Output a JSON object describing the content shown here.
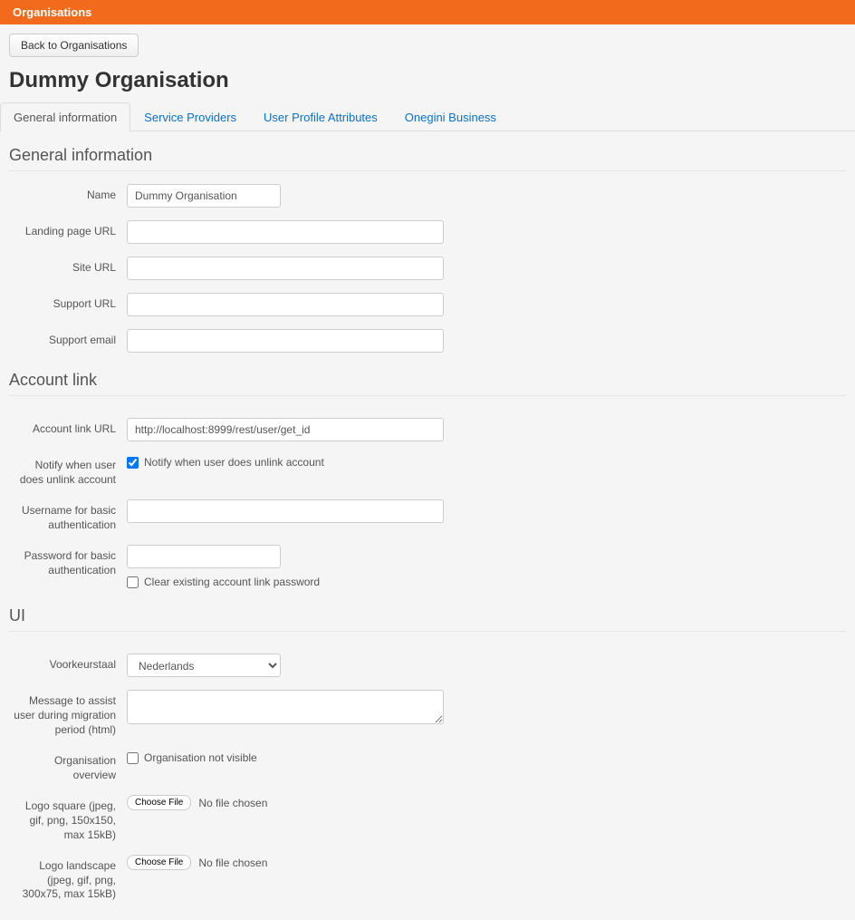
{
  "header": {
    "title": "Organisations"
  },
  "toolbar": {
    "back_label": "Back to Organisations"
  },
  "page": {
    "title": "Dummy Organisation"
  },
  "tabs": [
    {
      "label": "General information"
    },
    {
      "label": "Service Providers"
    },
    {
      "label": "User Profile Attributes"
    },
    {
      "label": "Onegini Business"
    }
  ],
  "sections": {
    "general": {
      "title": "General information",
      "fields": {
        "name": {
          "label": "Name",
          "value": "Dummy Organisation"
        },
        "landing_url": {
          "label": "Landing page URL",
          "value": ""
        },
        "site_url": {
          "label": "Site URL",
          "value": ""
        },
        "support_url": {
          "label": "Support URL",
          "value": ""
        },
        "support_email": {
          "label": "Support email",
          "value": ""
        }
      }
    },
    "account_link": {
      "title": "Account link",
      "fields": {
        "url": {
          "label": "Account link URL",
          "value": "http://localhost:8999/rest/user/get_id"
        },
        "notify": {
          "label": "Notify when user does unlink account",
          "checkbox_label": "Notify when user does unlink account"
        },
        "username": {
          "label": "Username for basic authentication",
          "value": ""
        },
        "password": {
          "label": "Password for basic authentication",
          "value": "",
          "clear_label": "Clear existing account link password"
        }
      }
    },
    "ui": {
      "title": "UI",
      "fields": {
        "language": {
          "label": "Voorkeurstaal",
          "selected": "Nederlands"
        },
        "migration_msg": {
          "label": "Message to assist user during migration period (html)",
          "value": ""
        },
        "overview": {
          "label": "Organisation overview",
          "checkbox_label": "Organisation not visible"
        },
        "logo_square": {
          "label": "Logo square (jpeg, gif, png, 150x150, max 15kB)",
          "button": "Choose File",
          "status": "No file chosen"
        },
        "logo_landscape": {
          "label": "Logo landscape (jpeg, gif, png, 300x75, max 15kB)",
          "button": "Choose File",
          "status": "No file chosen"
        }
      }
    }
  }
}
